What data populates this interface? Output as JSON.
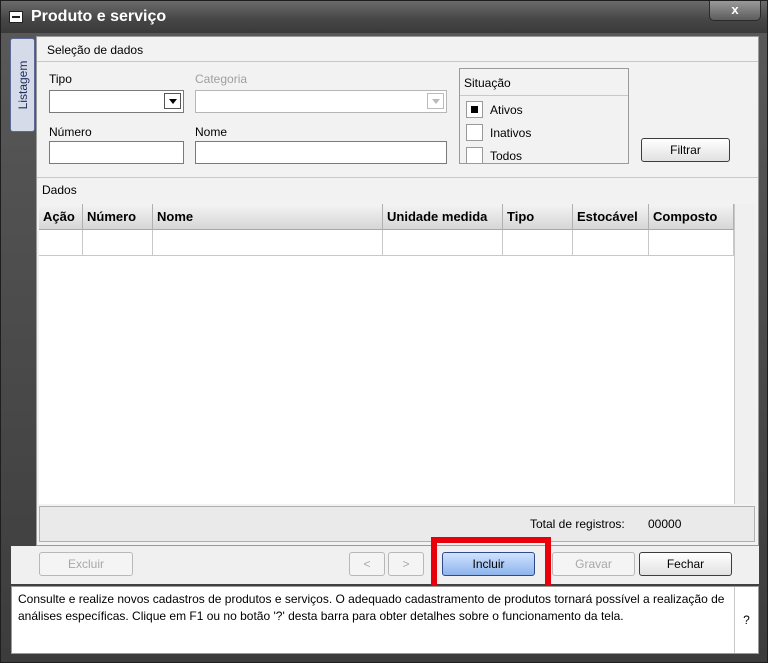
{
  "window": {
    "title": "Produto e serviço",
    "close_label": "x"
  },
  "sidetab": {
    "label": "Listagem"
  },
  "filters": {
    "section_title": "Seleção de dados",
    "tipo_label": "Tipo",
    "tipo_value": "",
    "categoria_label": "Categoria",
    "categoria_value": "",
    "numero_label": "Número",
    "numero_value": "",
    "nome_label": "Nome",
    "nome_value": "",
    "situacao": {
      "title": "Situação",
      "options": [
        {
          "label": "Ativos",
          "checked": true
        },
        {
          "label": "Inativos",
          "checked": false
        },
        {
          "label": "Todos",
          "checked": false
        }
      ]
    },
    "filter_button": "Filtrar"
  },
  "data": {
    "section_title": "Dados",
    "columns": [
      "Ação",
      "Número",
      "Nome",
      "Unidade medida",
      "Tipo",
      "Estocável",
      "Composto"
    ],
    "rows": [
      [
        "",
        "",
        "",
        "",
        "",
        "",
        ""
      ]
    ],
    "total_label": "Total de registros:",
    "total_value": "00000"
  },
  "actions": {
    "excluir": "Excluir",
    "prev": "<",
    "next": ">",
    "incluir": "Incluir",
    "gravar": "Gravar",
    "fechar": "Fechar"
  },
  "status": {
    "text": "Consulte e realize novos cadastros de produtos e serviços. O adequado cadastramento de produtos tornará possível a realização de análises específicas. Clique em F1 ou no botão '?' desta barra para obter detalhes sobre o funcionamento da tela.",
    "help_label": "?"
  },
  "colors": {
    "highlight": "#e8000b",
    "titlebar": "#474747",
    "accent": "#8db4ec"
  }
}
